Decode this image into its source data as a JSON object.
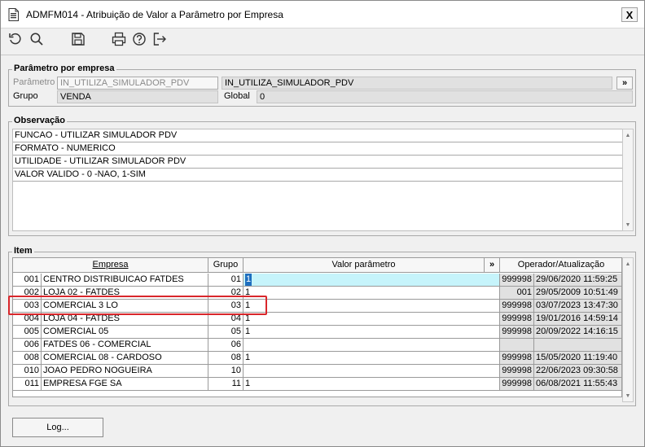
{
  "window": {
    "title": "ADMFM014 - Atribuição de Valor a Parâmetro por Empresa",
    "close_label": "X"
  },
  "toolbar": {
    "icons": [
      "refresh-icon",
      "search-icon",
      "save-icon",
      "print-icon",
      "help-icon",
      "exit-icon"
    ]
  },
  "parametro": {
    "legend": "Parâmetro por empresa",
    "parametro_label": "Parâmetro",
    "parametro_value": "IN_UTILIZA_SIMULADOR_PDV",
    "descricao_value": "IN_UTILIZA_SIMULADOR_PDV",
    "expand_label": "»",
    "grupo_label": "Grupo",
    "grupo_value": "VENDA",
    "global_label": "Global",
    "global_value": "0"
  },
  "observacao": {
    "legend": "Observação",
    "lines": [
      "FUNCAO - UTILIZAR SIMULADOR PDV",
      "FORMATO - NUMERICO",
      "UTILIDADE -  UTILIZAR SIMULADOR PDV",
      "VALOR VALIDO - 0 -NAO, 1-SIM"
    ]
  },
  "item": {
    "legend": "Item",
    "headers": {
      "empresa": "Empresa",
      "grupo": "Grupo",
      "valor": "Valor parâmetro",
      "expand": "»",
      "operador": "Operador/Atualização"
    },
    "rows": [
      {
        "code": "001",
        "name": "CENTRO DISTRIBUICAO FATDES",
        "grupo": "01",
        "valor": "1",
        "operador": "999998",
        "data": "29/06/2020 11:59:25"
      },
      {
        "code": "002",
        "name": "LOJA 02 - FATDES",
        "grupo": "02",
        "valor": "1",
        "operador": "001",
        "data": "29/05/2009 10:51:49"
      },
      {
        "code": "003",
        "name": "COMERCIAL 3 LO",
        "grupo": "03",
        "valor": "1",
        "operador": "999998",
        "data": "03/07/2023 13:47:30"
      },
      {
        "code": "004",
        "name": "LOJA 04 - FATDES",
        "grupo": "04",
        "valor": "1",
        "operador": "999998",
        "data": "19/01/2016 14:59:14"
      },
      {
        "code": "005",
        "name": "COMERCIAL 05",
        "grupo": "05",
        "valor": "1",
        "operador": "999998",
        "data": "20/09/2022 14:16:15"
      },
      {
        "code": "006",
        "name": "FATDES 06 - COMERCIAL",
        "grupo": "06",
        "valor": "",
        "operador": "",
        "data": ""
      },
      {
        "code": "008",
        "name": "COMERCIAL 08 - CARDOSO",
        "grupo": "08",
        "valor": "1",
        "operador": "999998",
        "data": "15/05/2020 11:19:40"
      },
      {
        "code": "010",
        "name": "JOAO PEDRO NOGUEIRA",
        "grupo": "10",
        "valor": "",
        "operador": "999998",
        "data": "22/06/2023 09:30:58"
      },
      {
        "code": "011",
        "name": "EMPRESA FGE SA",
        "grupo": "11",
        "valor": "1",
        "operador": "999998",
        "data": "06/08/2021 11:55:43"
      }
    ]
  },
  "footer": {
    "log_label": "Log..."
  }
}
